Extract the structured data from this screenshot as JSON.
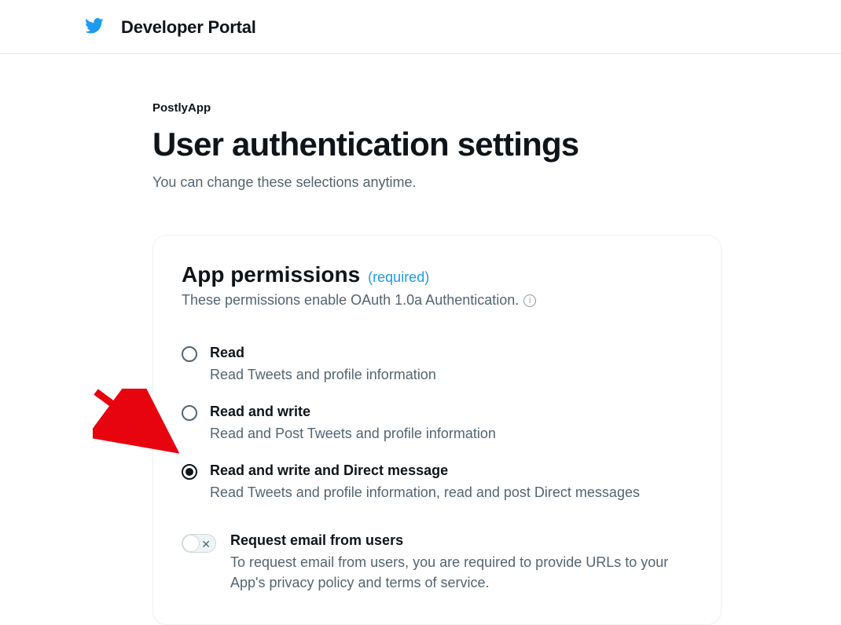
{
  "header": {
    "title": "Developer Portal"
  },
  "page": {
    "app_name": "PostlyApp",
    "title": "User authentication settings",
    "subtitle": "You can change these selections anytime."
  },
  "permissions": {
    "title": "App permissions",
    "required_label": "(required)",
    "description": "These permissions enable OAuth 1.0a Authentication.",
    "options": [
      {
        "label": "Read",
        "description": "Read Tweets and profile information",
        "selected": false
      },
      {
        "label": "Read and write",
        "description": "Read and Post Tweets and profile information",
        "selected": false
      },
      {
        "label": "Read and write and Direct message",
        "description": "Read Tweets and profile information, read and post Direct messages",
        "selected": true
      }
    ],
    "request_email": {
      "label": "Request email from users",
      "description": "To request email from users, you are required to provide URLs to your App's privacy policy and terms of service.",
      "enabled": false
    }
  }
}
